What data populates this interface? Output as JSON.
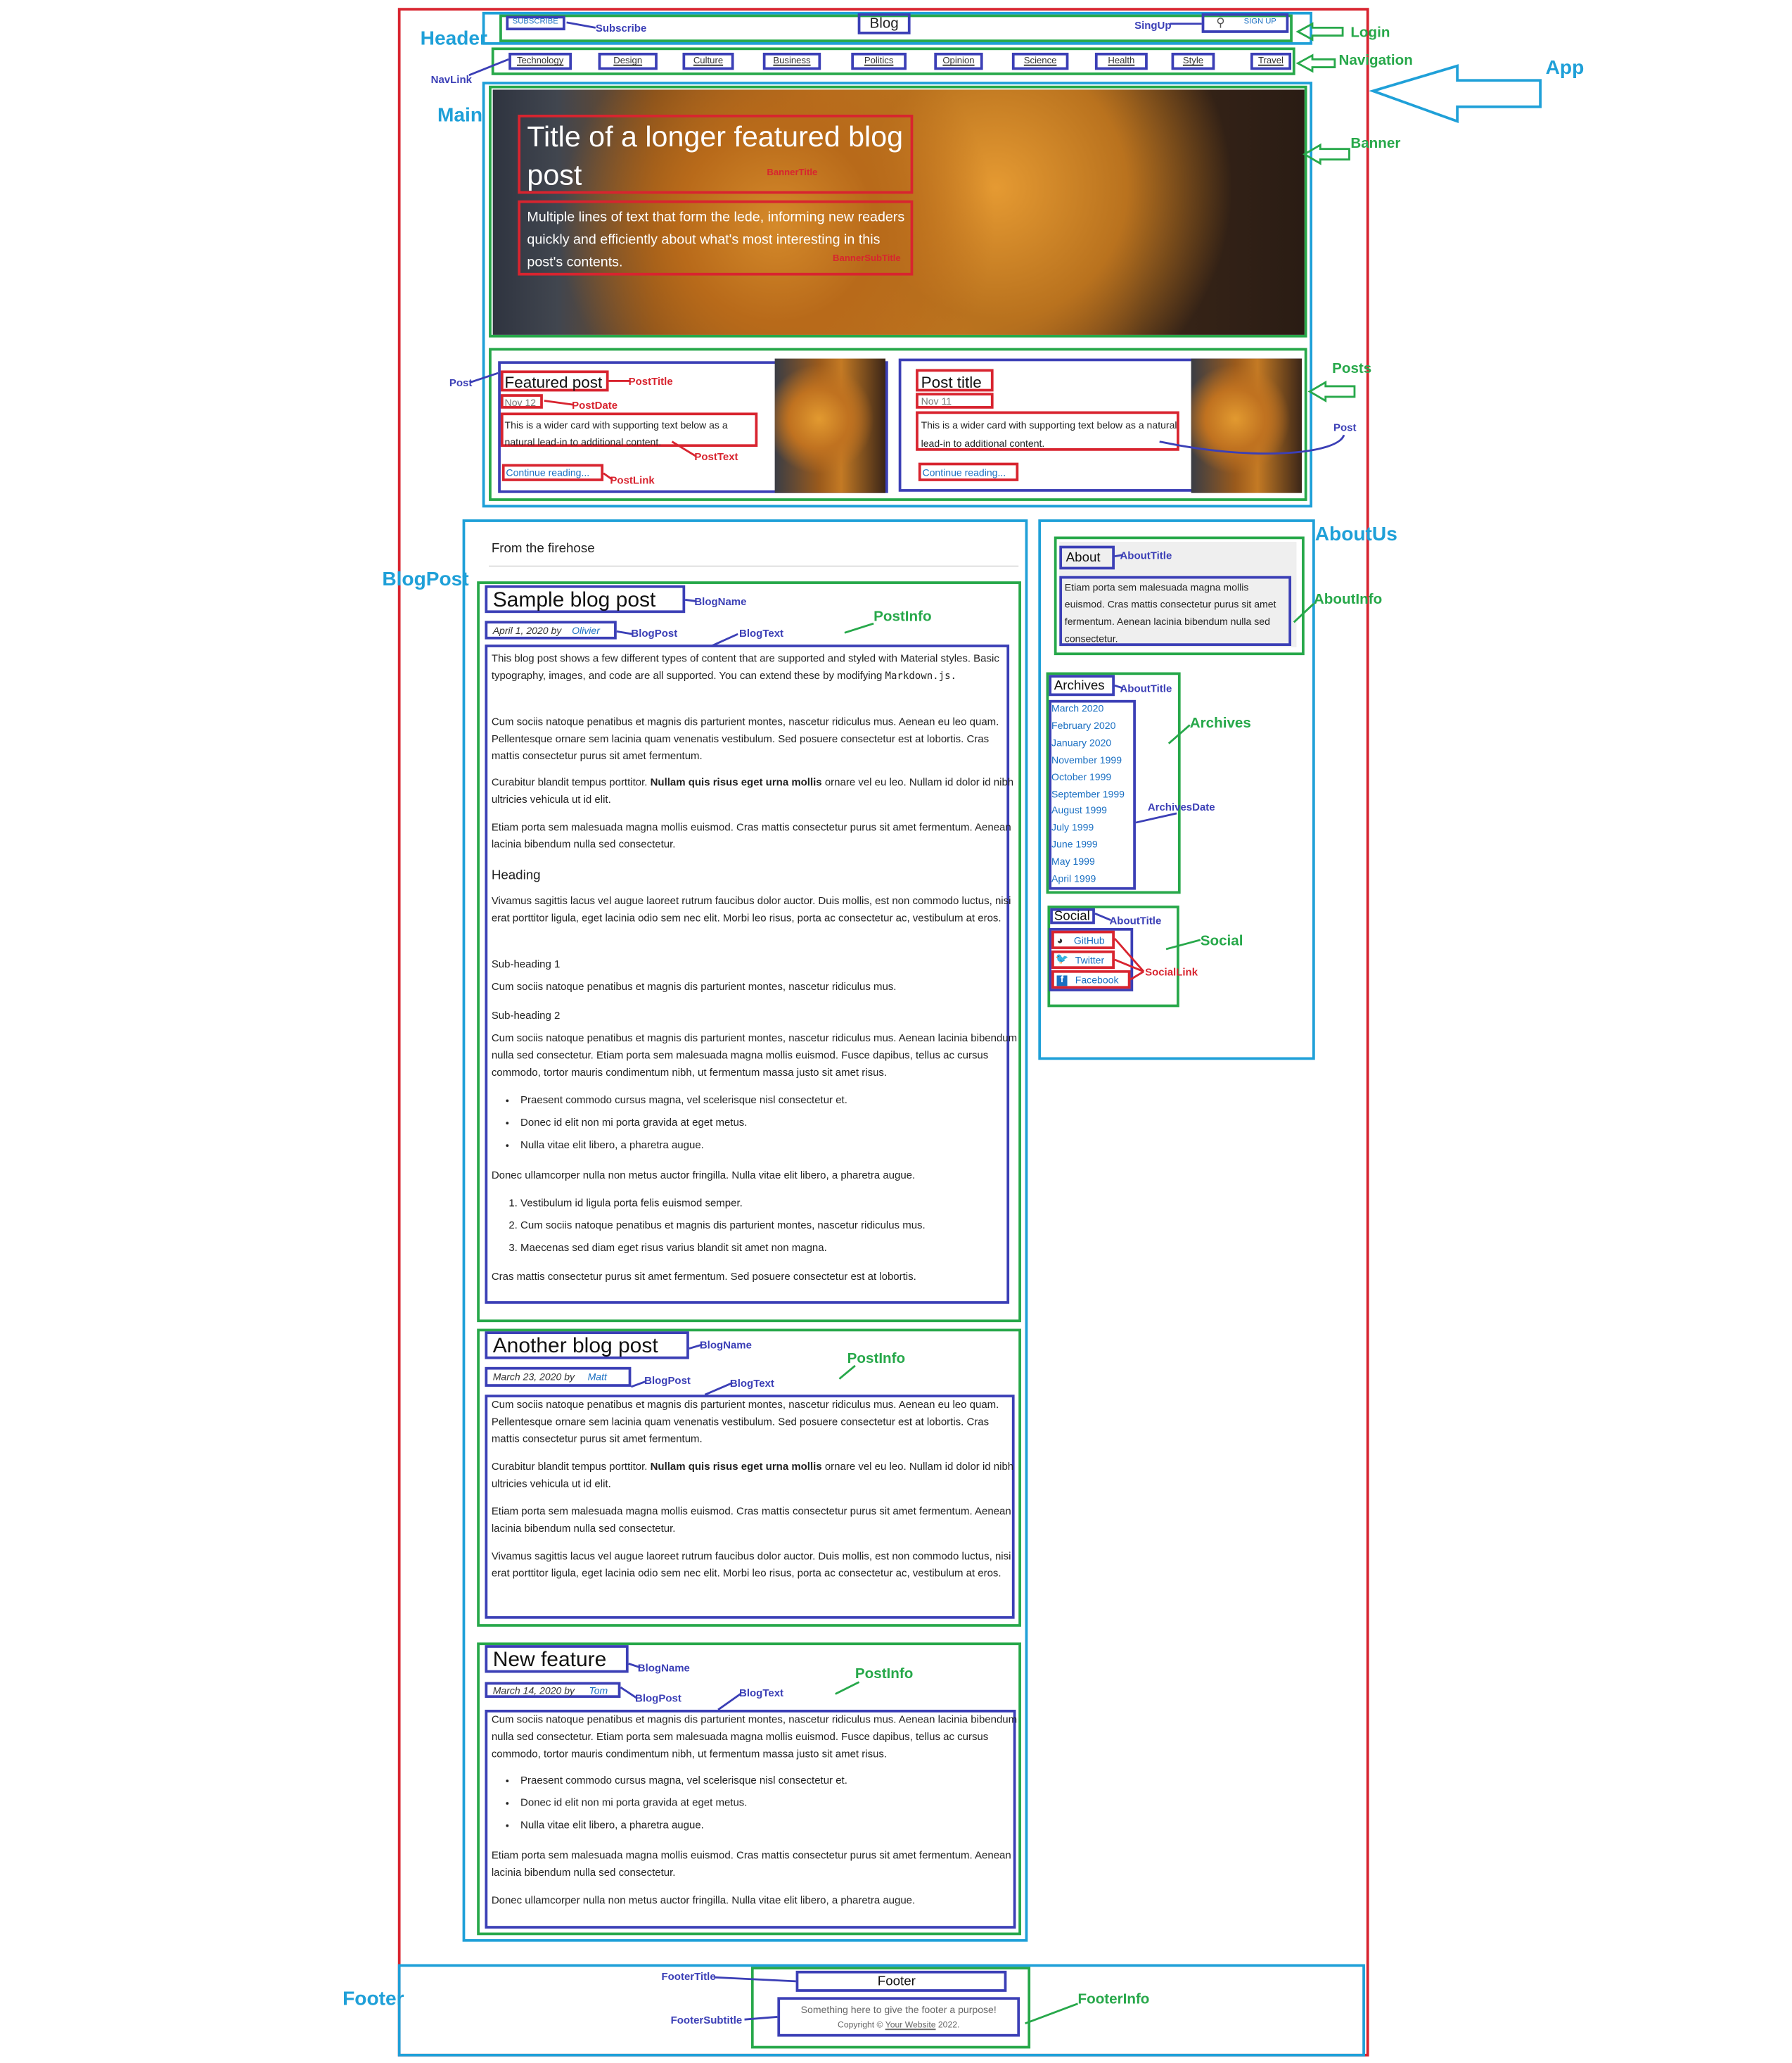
{
  "header": {
    "subscribe": "SUBSCRIBE",
    "title": "Blog",
    "signup": "SIGN UP"
  },
  "nav": [
    "Technology",
    "Design",
    "Culture",
    "Business",
    "Politics",
    "Opinion",
    "Science",
    "Health",
    "Style",
    "Travel"
  ],
  "banner": {
    "title": "Title of a longer featured blog post",
    "subtitle": "Multiple lines of text that form the lede, informing new readers quickly and efficiently about what's most interesting in this post's contents.",
    "title_label": "BannerTitle",
    "subtitle_label": "BannerSubTitle"
  },
  "posts": [
    {
      "title": "Featured post",
      "date": "Nov 12",
      "text": "This is a wider card with supporting text below as a natural lead-in to additional content.",
      "link": "Continue reading..."
    },
    {
      "title": "Post title",
      "date": "Nov 11",
      "text": "This is a wider card with supporting text below as a natural lead-in to additional content.",
      "link": "Continue reading..."
    }
  ],
  "firehose": "From the firehose",
  "blog_posts": [
    {
      "name": "Sample blog post",
      "date": "April 1, 2020 by",
      "author": "Olivier",
      "intro": "This blog post shows a few different types of content that are supported and styled with Material styles. Basic typography, images, and code are all supported. You can extend these by modifying",
      "code": "Markdown.js.",
      "p1": "Cum sociis natoque penatibus et magnis dis parturient montes, nascetur ridiculus mus. Aenean eu leo quam. Pellentesque ornare sem lacinia quam venenatis vestibulum. Sed posuere consectetur est at lobortis. Cras mattis consectetur purus sit amet fermentum.",
      "p2_pre": "Curabitur blandit tempus porttitor.",
      "p2_bold": "Nullam quis risus eget urna mollis",
      "p2_post": "ornare vel eu leo. Nullam id dolor id nibh ultricies vehicula ut id elit.",
      "p3": "Etiam porta sem malesuada magna mollis euismod. Cras mattis consectetur purus sit amet fermentum. Aenean lacinia bibendum nulla sed consectetur.",
      "heading": "Heading",
      "p4": "Vivamus sagittis lacus vel augue laoreet rutrum faucibus dolor auctor. Duis mollis, est non commodo luctus, nisi erat porttitor ligula, eget lacinia odio sem nec elit. Morbi leo risus, porta ac consectetur ac, vestibulum at eros.",
      "sub1": "Sub-heading 1",
      "p5": "Cum sociis natoque penatibus et magnis dis parturient montes, nascetur ridiculus mus.",
      "sub2": "Sub-heading 2",
      "p6": "Cum sociis natoque penatibus et magnis dis parturient montes, nascetur ridiculus mus. Aenean lacinia bibendum nulla sed consectetur. Etiam porta sem malesuada magna mollis euismod. Fusce dapibus, tellus ac cursus commodo, tortor mauris condimentum nibh, ut fermentum massa justo sit amet risus.",
      "bullets": [
        "Praesent commodo cursus magna, vel scelerisque nisl consectetur et.",
        "Donec id elit non mi porta gravida at eget metus.",
        "Nulla vitae elit libero, a pharetra augue."
      ],
      "p7": "Donec ullamcorper nulla non metus auctor fringilla. Nulla vitae elit libero, a pharetra augue.",
      "numbered": [
        "Vestibulum id ligula porta felis euismod semper.",
        "Cum sociis natoque penatibus et magnis dis parturient montes, nascetur ridiculus mus.",
        "Maecenas sed diam eget risus varius blandit sit amet non magna."
      ],
      "p8": "Cras mattis consectetur purus sit amet fermentum. Sed posuere consectetur est at lobortis."
    },
    {
      "name": "Another blog post",
      "date": "March 23, 2020 by",
      "author": "Matt",
      "p1": "Cum sociis natoque penatibus et magnis dis parturient montes, nascetur ridiculus mus. Aenean eu leo quam. Pellentesque ornare sem lacinia quam venenatis vestibulum. Sed posuere consectetur est at lobortis. Cras mattis consectetur purus sit amet fermentum.",
      "p2_pre": "Curabitur blandit tempus porttitor.",
      "p2_bold": "Nullam quis risus eget urna mollis",
      "p2_post": "ornare vel eu leo. Nullam id dolor id nibh ultricies vehicula ut id elit.",
      "p3": "Etiam porta sem malesuada magna mollis euismod. Cras mattis consectetur purus sit amet fermentum. Aenean lacinia bibendum nulla sed consectetur.",
      "p4": "Vivamus sagittis lacus vel augue laoreet rutrum faucibus dolor auctor. Duis mollis, est non commodo luctus, nisi erat porttitor ligula, eget lacinia odio sem nec elit. Morbi leo risus, porta ac consectetur ac, vestibulum at eros."
    },
    {
      "name": "New feature",
      "date": "March 14, 2020 by",
      "author": "Tom",
      "p1": "Cum sociis natoque penatibus et magnis dis parturient montes, nascetur ridiculus mus. Aenean lacinia bibendum nulla sed consectetur. Etiam porta sem malesuada magna mollis euismod. Fusce dapibus, tellus ac cursus commodo, tortor mauris condimentum nibh, ut fermentum massa justo sit amet risus.",
      "bullets": [
        "Praesent commodo cursus magna, vel scelerisque nisl consectetur et.",
        "Donec id elit non mi porta gravida at eget metus.",
        "Nulla vitae elit libero, a pharetra augue."
      ],
      "p2": "Etiam porta sem malesuada magna mollis euismod. Cras mattis consectetur purus sit amet fermentum. Aenean lacinia bibendum nulla sed consectetur.",
      "p3": "Donec ullamcorper nulla non metus auctor fringilla. Nulla vitae elit libero, a pharetra augue."
    }
  ],
  "about": {
    "title": "About",
    "text": "Etiam porta sem malesuada magna mollis euismod. Cras mattis consectetur purus sit amet fermentum. Aenean lacinia bibendum nulla sed consectetur."
  },
  "archives": {
    "title": "Archives",
    "items": [
      "March 2020",
      "February 2020",
      "January 2020",
      "November 1999",
      "October 1999",
      "September 1999",
      "August 1999",
      "July 1999",
      "June 1999",
      "May 1999",
      "April 1999"
    ]
  },
  "social": {
    "title": "Social",
    "items": [
      "GitHub",
      "Twitter",
      "Facebook"
    ]
  },
  "footer": {
    "title": "Footer",
    "subtitle": "Something here to give the footer a purpose!",
    "copyright_pre": "Copyright ©",
    "copyright_link": "Your Website",
    "copyright_post": "2022."
  },
  "annotations": {
    "app": "App",
    "header": "Header",
    "main": "Main",
    "blogpost": "BlogPost",
    "footer": "Footer",
    "aboutus": "AboutUs",
    "login": "Login",
    "navigation": "Navigation",
    "banner": "Banner",
    "posts": "Posts",
    "aboutinfo": "AboutInfo",
    "archives": "Archives",
    "social": "Social",
    "postinfo": "PostInfo",
    "footerinfo": "FooterInfo",
    "subscribe": "Subscribe",
    "signup": "SingUp",
    "navlink": "NavLink",
    "post": "Post",
    "blogname": "BlogName",
    "blogpost_small": "BlogPost",
    "blogtext": "BlogText",
    "abouttitle": "AboutTitle",
    "archivesdate": "ArchivesDate",
    "footertitle": "FooterTitle",
    "footersubtitle": "FooterSubtitle",
    "posttitle": "PostTitle",
    "postdate": "PostDate",
    "posttext": "PostText",
    "postlink": "PostLink",
    "sociallink": "SocialLink"
  },
  "colors": {
    "app": "#d8242f",
    "region": "#1fa0d8",
    "group": "#27a84a",
    "component": "#3b3fb6",
    "leaf": "#d8242f"
  }
}
